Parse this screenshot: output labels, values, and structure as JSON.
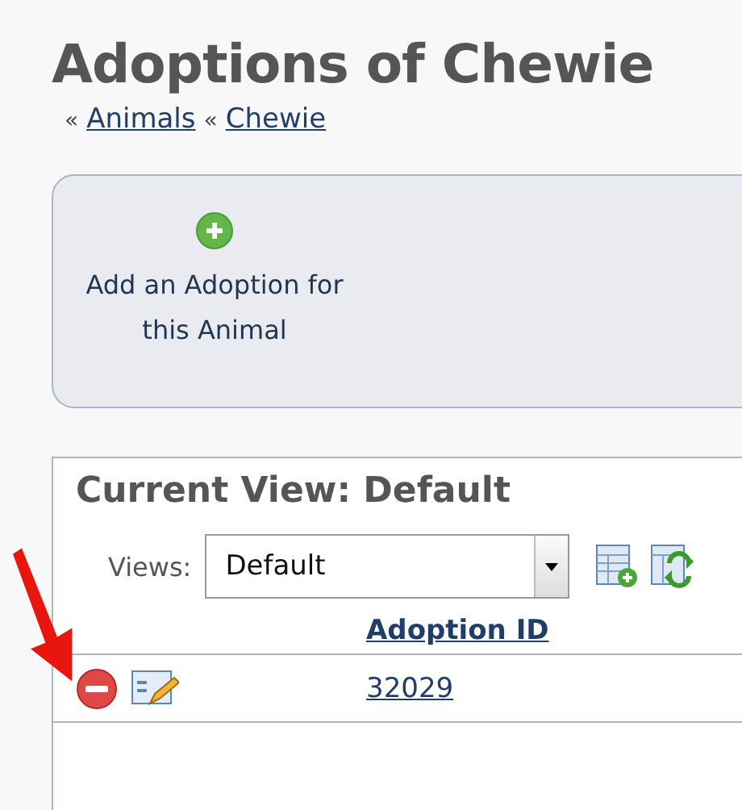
{
  "title": "Adoptions of Chewie",
  "breadcrumbs": [
    {
      "separator": "«",
      "label": "Animals"
    },
    {
      "separator": "«",
      "label": "Chewie"
    }
  ],
  "actions": [
    {
      "label": "Add an Adoption for this Animal"
    }
  ],
  "view_panel": {
    "title": "Current View: Default",
    "views_label": "Views:",
    "views_value": "Default"
  },
  "table": {
    "columns": [
      "Adoption ID"
    ],
    "rows": [
      {
        "adoption_id": "32029"
      }
    ]
  },
  "annotation": {
    "kind": "arrow"
  }
}
